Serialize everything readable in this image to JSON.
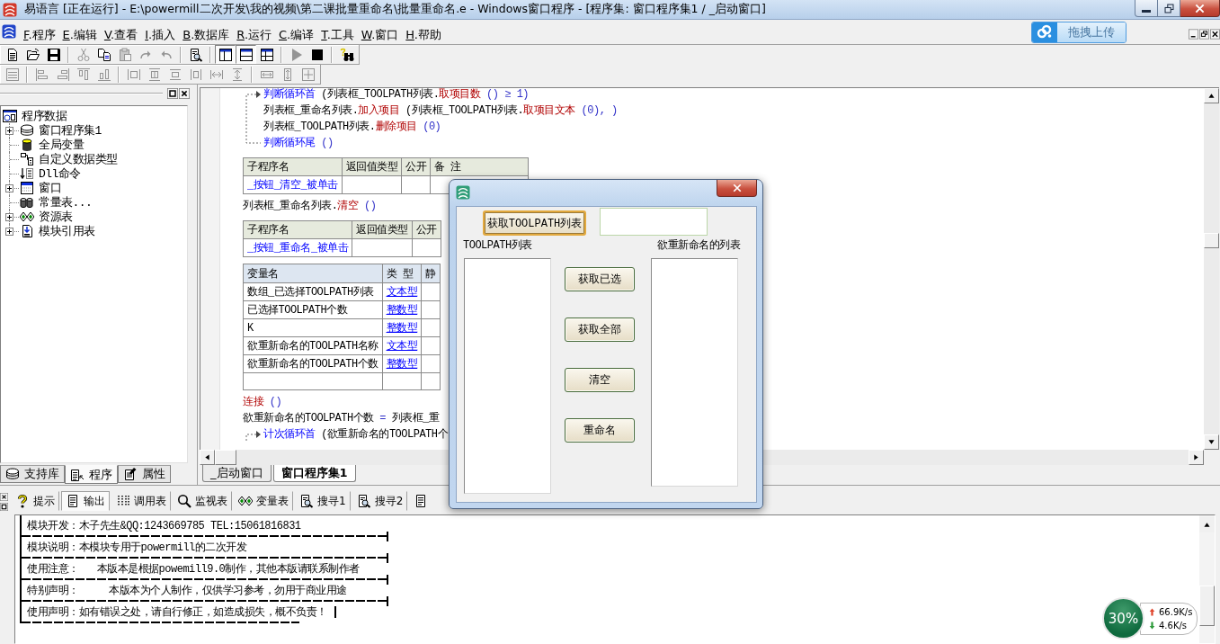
{
  "window": {
    "title": "易语言 [正在运行] - E:\\powermill二次开发\\我的视频\\第二课批量重命名\\批量重命名.e - Windows窗口程序 - [程序集: 窗口程序集1 / _启动窗口]"
  },
  "menu": [
    {
      "label": "F.程序"
    },
    {
      "label": "E.编辑"
    },
    {
      "label": "V.查看"
    },
    {
      "label": "I.插入"
    },
    {
      "label": "B.数据库"
    },
    {
      "label": "R.运行"
    },
    {
      "label": "C.编译"
    },
    {
      "label": "T.工具"
    },
    {
      "label": "W.窗口"
    },
    {
      "label": "H.帮助"
    }
  ],
  "upload_button": {
    "label": "拖拽上传"
  },
  "toolbar_1": [
    [
      {
        "disabled": false,
        "pressed": false
      },
      {
        "disabled": false,
        "pressed": false
      },
      {
        "disabled": false,
        "pressed": false
      }
    ],
    [
      {
        "disabled": true,
        "pressed": false
      },
      {
        "disabled": false,
        "pressed": false
      },
      {
        "disabled": true,
        "pressed": false
      },
      {
        "disabled": true,
        "pressed": false
      },
      {
        "disabled": true,
        "pressed": false
      }
    ],
    [
      {
        "disabled": false,
        "pressed": false
      }
    ],
    [
      {
        "disabled": false,
        "pressed": true
      },
      {
        "disabled": false,
        "pressed": true
      },
      {
        "disabled": false,
        "pressed": false
      }
    ],
    [
      {
        "disabled": true,
        "pressed": false
      },
      {
        "disabled": false,
        "pressed": false
      }
    ],
    [
      {
        "disabled": false,
        "pressed": false
      }
    ]
  ],
  "toolbar_2": [
    [
      {
        "disabled": true
      }
    ],
    [
      {
        "disabled": true
      },
      {
        "disabled": true
      },
      {
        "disabled": true
      },
      {
        "disabled": true
      }
    ],
    [
      {
        "disabled": true
      },
      {
        "disabled": true
      },
      {
        "disabled": true
      },
      {
        "disabled": true
      },
      {
        "disabled": true
      },
      {
        "disabled": true
      }
    ],
    [
      {
        "disabled": true
      },
      {
        "disabled": true
      },
      {
        "disabled": true
      }
    ]
  ],
  "project_panel": {
    "tree": {
      "label": "程序数据",
      "children": [
        {
          "label": "窗口程序集1",
          "kind": "node",
          "expanded": false
        },
        {
          "label": "全局变量",
          "kind": "leaf"
        },
        {
          "label": "自定义数据类型",
          "kind": "leaf"
        },
        {
          "label": "Dll命令",
          "kind": "leaf"
        },
        {
          "label": "窗口",
          "kind": "node",
          "expanded": false
        },
        {
          "label": "常量表...",
          "kind": "leaf"
        },
        {
          "label": "资源表",
          "kind": "node",
          "expanded": false
        },
        {
          "label": "模块引用表",
          "kind": "node",
          "expanded": false
        }
      ]
    },
    "tabs": [
      {
        "label": "支持库",
        "selected": false
      },
      {
        "label": "程序",
        "selected": true
      },
      {
        "label": "属性",
        "selected": false
      }
    ]
  },
  "editor": {
    "blocks": [
      {
        "kind": "loop",
        "head": [
          {
            "kind": "command",
            "text": "判断循环首"
          },
          {
            "kind": "plain",
            "text": " (列表框_TOOLPATH列表."
          },
          {
            "kind": "method",
            "text": "取项目数"
          },
          {
            "kind": "paren",
            "text": " () ≥ 1)"
          }
        ],
        "body": [
          [
            {
              "kind": "plain",
              "text": "列表框_重命名列表."
            },
            {
              "kind": "method",
              "text": "加入项目"
            },
            {
              "kind": "plain",
              "text": " (列表框_TOOLPATH列表."
            },
            {
              "kind": "method",
              "text": "取项目文本"
            },
            {
              "kind": "paren",
              "text": " (0), )"
            }
          ],
          [
            {
              "kind": "plain",
              "text": "列表框_TOOLPATH列表."
            },
            {
              "kind": "method",
              "text": "删除项目"
            },
            {
              "kind": "paren",
              "text": " (0)"
            }
          ]
        ],
        "tail": [
          {
            "kind": "command",
            "text": "判断循环尾"
          },
          {
            "kind": "paren",
            "text": " ()"
          }
        ]
      },
      {
        "kind": "subroutine_table",
        "columns": [
          "子程序名",
          "返回值类型",
          "公开",
          "备 注"
        ],
        "rows": [
          {
            "name": "_按钮_清空_被单击"
          }
        ]
      },
      {
        "kind": "line",
        "segments": [
          {
            "kind": "plain",
            "text": "列表框_重命名列表."
          },
          {
            "kind": "method",
            "text": "清空"
          },
          {
            "kind": "paren",
            "text": " ()"
          }
        ]
      },
      {
        "kind": "subroutine_table",
        "columns": [
          "子程序名",
          "返回值类型",
          "公开"
        ],
        "rows": [
          {
            "name": "_按钮_重命名_被单击"
          }
        ]
      },
      {
        "kind": "variable_table",
        "columns": [
          "变量名",
          "类 型",
          "静"
        ],
        "rows": [
          {
            "name": "数组_已选择TOOLPATH列表",
            "type": "文本型"
          },
          {
            "name": "已选择TOOLPATH个数",
            "type": "整数型"
          },
          {
            "name": "K",
            "type": "整数型"
          },
          {
            "name": "欲重新命名的TOOLPATH名称",
            "type": "文本型"
          },
          {
            "name": "欲重新命名的TOOLPATH个数",
            "type": "整数型"
          }
        ]
      },
      {
        "kind": "line",
        "segments": [
          {
            "kind": "method",
            "text": "连接"
          },
          {
            "kind": "paren",
            "text": " ()"
          }
        ]
      },
      {
        "kind": "line",
        "segments": [
          {
            "kind": "plain",
            "text": "欲重新命名的TOOLPATH个数 "
          },
          {
            "kind": "paren",
            "text": "="
          },
          {
            "kind": "plain",
            "text": " 列表框_重"
          }
        ]
      },
      {
        "kind": "loop",
        "head": [
          {
            "kind": "command",
            "text": "计次循环首"
          },
          {
            "kind": "plain",
            "text": " (欲重新命名的TOOLPATH个"
          }
        ]
      }
    ],
    "tabs": [
      {
        "label": "_启动窗口",
        "selected": false
      },
      {
        "label": "窗口程序集1",
        "selected": true
      }
    ]
  },
  "output_panel": {
    "tabs": [
      {
        "label": "提示",
        "selected": false
      },
      {
        "label": "输出",
        "selected": true
      },
      {
        "label": "调用表",
        "selected": false
      },
      {
        "label": "监视表",
        "selected": false
      },
      {
        "label": "变量表",
        "selected": false
      },
      {
        "label": "搜寻1",
        "selected": false
      },
      {
        "label": "搜寻2",
        "selected": false
      },
      {
        "selected": false
      }
    ],
    "lines": [
      "模块开发：木子先生&QQ:1243669785 TEL:15061816831",
      "模块说明：本模块专用于powermill的二次开发",
      "使用注意：   本版本是根据powemill9.0制作，其他本版请联系制作者",
      "特别声明：     本版本为个人制作，仅供学习参考，勿用于商业用途",
      "使用声明：如有错误之处，请自行修正，如造成损失，概不负责！"
    ]
  },
  "dialog": {
    "primary_button": {
      "label": "获取TOOLPATH列表",
      "focused": true
    },
    "list_labels": [
      "TOOLPATH列表",
      "欲重新命名的列表"
    ],
    "buttons": [
      {
        "label": "获取已选"
      },
      {
        "label": "获取全部"
      },
      {
        "label": "清空"
      },
      {
        "label": "重命名"
      }
    ]
  },
  "speed_widget": {
    "percent": "30%",
    "upload": "66.9K/s",
    "download": "4.6K/s"
  }
}
